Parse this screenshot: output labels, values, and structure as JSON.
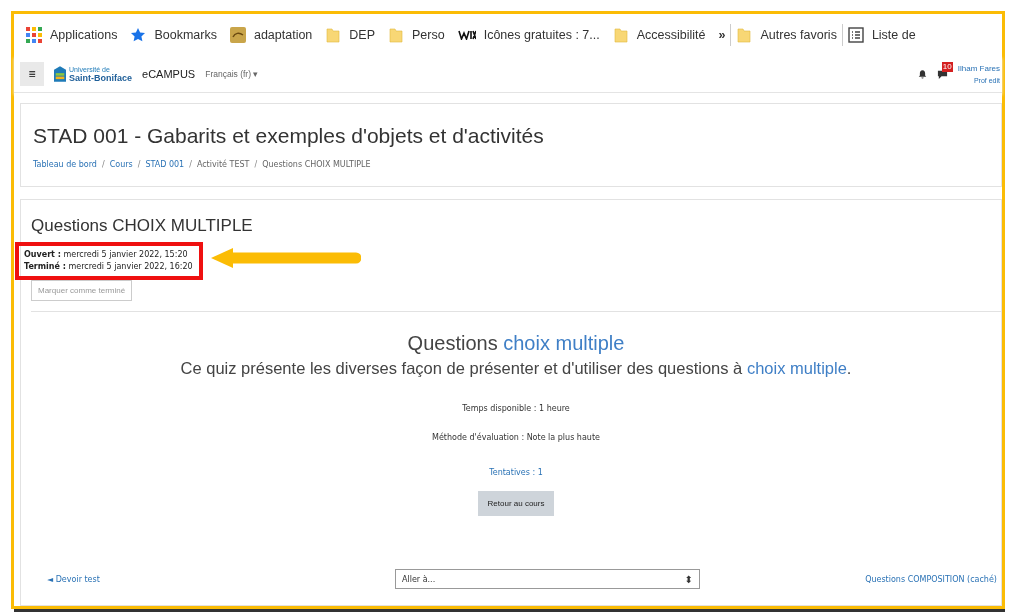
{
  "bookmarks": [
    {
      "kind": "apps",
      "label": "Applications"
    },
    {
      "kind": "star",
      "label": "Bookmarks"
    },
    {
      "kind": "favicon",
      "label": "adaptation"
    },
    {
      "kind": "folder",
      "label": "DEP"
    },
    {
      "kind": "folder",
      "label": "Perso"
    },
    {
      "kind": "wix",
      "label": "Icônes gratuites : 7..."
    },
    {
      "kind": "folder",
      "label": "Accessibilité"
    },
    {
      "kind": "more",
      "label": "»"
    },
    {
      "kind": "folder",
      "label": "Autres favoris"
    },
    {
      "kind": "list",
      "label": "Liste de"
    }
  ],
  "navbar": {
    "menu": "≡",
    "logo_top": "Université de",
    "logo_bottom": "Saint-Boniface",
    "site": "eCAMPUS",
    "language": "Français (fr) ▾",
    "messages_badge": "10",
    "user_name": "Ilham Fares",
    "user_role": "Prof edit"
  },
  "header": {
    "title": "STAD 001 - Gabarits et exemples d'objets et d'activités",
    "separator": "/",
    "breadcrumb": [
      {
        "label": "Tableau de bord",
        "link": true
      },
      {
        "label": "Cours",
        "link": true
      },
      {
        "label": "STAD 001",
        "link": true
      },
      {
        "label": "Activité TEST",
        "link": false
      },
      {
        "label": "Questions CHOIX MULTIPLE",
        "link": false
      }
    ]
  },
  "activity": {
    "title": "Questions CHOIX MULTIPLE",
    "dates": [
      {
        "label": "Ouvert :",
        "value": "mercredi 5 janvier 2022, 15:20"
      },
      {
        "label": "Terminé :",
        "value": "mercredi 5 janvier 2022, 16:20"
      }
    ],
    "mark_button": "Marquer comme terminé",
    "intro_title": "Questions *choix multiple*",
    "intro_text": "Ce quiz présente les diverses façon de présenter et d'utiliser des questions à *choix multiple*.",
    "time_limit": "Temps disponible : 1 heure",
    "grading": "Méthode d'évaluation : Note la plus haute",
    "attempts": "Tentatives : 1",
    "back_button": "Retour au cours"
  },
  "footer_nav": {
    "previous": "◄ Devoir test",
    "jump_placeholder": "Aller à...",
    "jump_arrow": "⬍",
    "next": "Questions COMPOSITION (caché)"
  }
}
